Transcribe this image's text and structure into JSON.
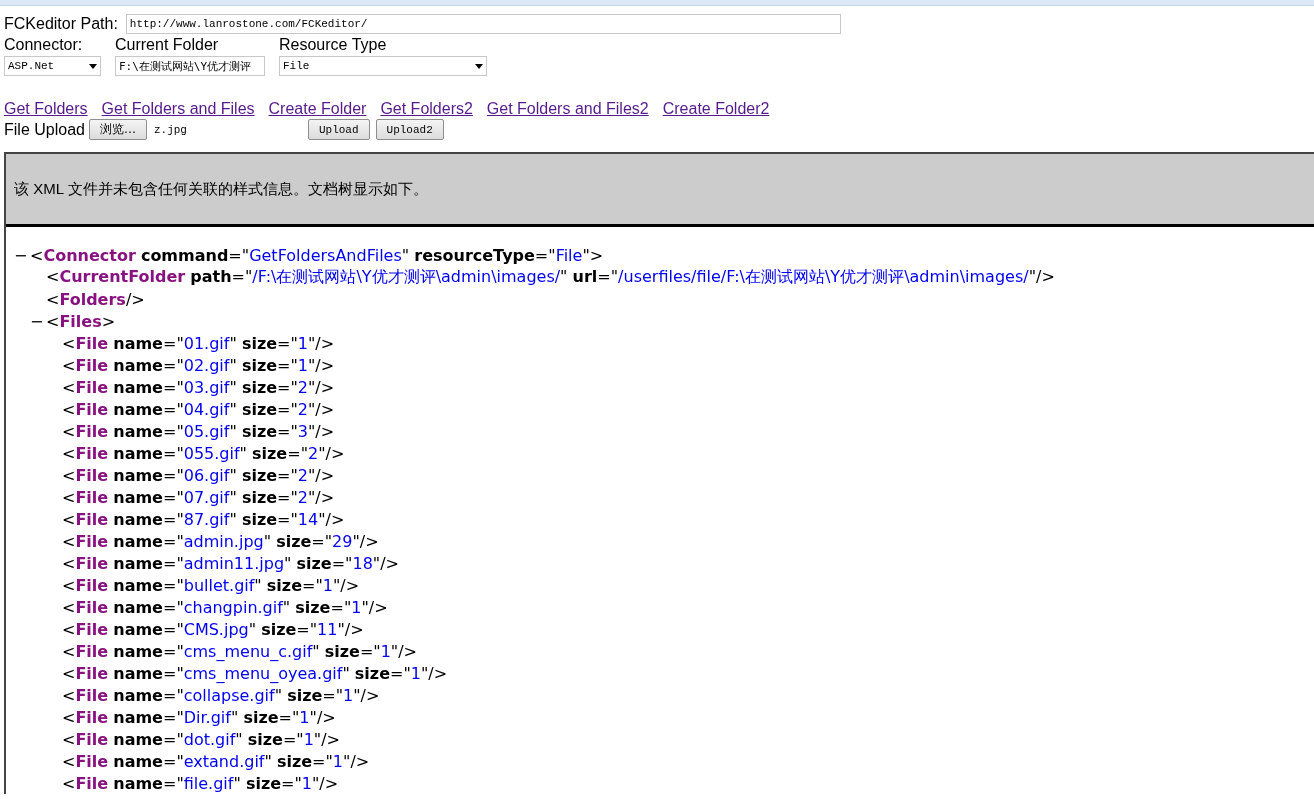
{
  "form": {
    "path_label": "FCKeditor Path:",
    "path_value": "http://www.lanrostone.com/FCKeditor/",
    "connector_label": "Connector:",
    "connector_value": "ASP.Net",
    "folder_label": "Current Folder",
    "folder_value": "F:\\在测试网站\\Y优才测评",
    "resource_label": "Resource Type",
    "resource_value": "File"
  },
  "links": [
    "Get Folders",
    "Get Folders and Files",
    "Create Folder",
    "Get Folders2",
    "Get Folders and Files2",
    "Create Folder2"
  ],
  "upload": {
    "label": "File Upload",
    "browse_button": "浏览…",
    "file_name": "z.jpg",
    "buttons": [
      "Upload",
      "Upload2"
    ]
  },
  "xml_viewer": {
    "notice": "该 XML 文件并未包含任何关联的样式信息。文档树显示如下。",
    "syntax": {
      "lt": "<",
      "gt": ">",
      "self_close": "/>",
      "eq": "=",
      "quote": "\""
    },
    "root": {
      "tag": "Connector",
      "toggle": "−",
      "attrs": [
        {
          "name": "command",
          "value": "GetFoldersAndFiles"
        },
        {
          "name": "resourceType",
          "value": "File"
        }
      ],
      "children": [
        {
          "tag": "CurrentFolder",
          "attrs": [
            {
              "name": "path",
              "value": "/F:\\在测试网站\\Y优才测评\\admin\\images/"
            },
            {
              "name": "url",
              "value": "/userfiles/file/F:\\在测试网站\\Y优才测评\\admin\\images/"
            }
          ]
        },
        {
          "tag": "Folders"
        },
        {
          "tag": "Files",
          "toggle": "−",
          "children": [
            {
              "tag": "File",
              "attrs": [
                {
                  "name": "name",
                  "value": "01.gif"
                },
                {
                  "name": "size",
                  "value": "1"
                }
              ]
            },
            {
              "tag": "File",
              "attrs": [
                {
                  "name": "name",
                  "value": "02.gif"
                },
                {
                  "name": "size",
                  "value": "1"
                }
              ]
            },
            {
              "tag": "File",
              "attrs": [
                {
                  "name": "name",
                  "value": "03.gif"
                },
                {
                  "name": "size",
                  "value": "2"
                }
              ]
            },
            {
              "tag": "File",
              "attrs": [
                {
                  "name": "name",
                  "value": "04.gif"
                },
                {
                  "name": "size",
                  "value": "2"
                }
              ]
            },
            {
              "tag": "File",
              "attrs": [
                {
                  "name": "name",
                  "value": "05.gif"
                },
                {
                  "name": "size",
                  "value": "3"
                }
              ]
            },
            {
              "tag": "File",
              "attrs": [
                {
                  "name": "name",
                  "value": "055.gif"
                },
                {
                  "name": "size",
                  "value": "2"
                }
              ]
            },
            {
              "tag": "File",
              "attrs": [
                {
                  "name": "name",
                  "value": "06.gif"
                },
                {
                  "name": "size",
                  "value": "2"
                }
              ]
            },
            {
              "tag": "File",
              "attrs": [
                {
                  "name": "name",
                  "value": "07.gif"
                },
                {
                  "name": "size",
                  "value": "2"
                }
              ]
            },
            {
              "tag": "File",
              "attrs": [
                {
                  "name": "name",
                  "value": "87.gif"
                },
                {
                  "name": "size",
                  "value": "14"
                }
              ]
            },
            {
              "tag": "File",
              "attrs": [
                {
                  "name": "name",
                  "value": "admin.jpg"
                },
                {
                  "name": "size",
                  "value": "29"
                }
              ]
            },
            {
              "tag": "File",
              "attrs": [
                {
                  "name": "name",
                  "value": "admin11.jpg"
                },
                {
                  "name": "size",
                  "value": "18"
                }
              ]
            },
            {
              "tag": "File",
              "attrs": [
                {
                  "name": "name",
                  "value": "bullet.gif"
                },
                {
                  "name": "size",
                  "value": "1"
                }
              ]
            },
            {
              "tag": "File",
              "attrs": [
                {
                  "name": "name",
                  "value": "changpin.gif"
                },
                {
                  "name": "size",
                  "value": "1"
                }
              ]
            },
            {
              "tag": "File",
              "attrs": [
                {
                  "name": "name",
                  "value": "CMS.jpg"
                },
                {
                  "name": "size",
                  "value": "11"
                }
              ]
            },
            {
              "tag": "File",
              "attrs": [
                {
                  "name": "name",
                  "value": "cms_menu_c.gif"
                },
                {
                  "name": "size",
                  "value": "1"
                }
              ]
            },
            {
              "tag": "File",
              "attrs": [
                {
                  "name": "name",
                  "value": "cms_menu_oyea.gif"
                },
                {
                  "name": "size",
                  "value": "1"
                }
              ]
            },
            {
              "tag": "File",
              "attrs": [
                {
                  "name": "name",
                  "value": "collapse.gif"
                },
                {
                  "name": "size",
                  "value": "1"
                }
              ]
            },
            {
              "tag": "File",
              "attrs": [
                {
                  "name": "name",
                  "value": "Dir.gif"
                },
                {
                  "name": "size",
                  "value": "1"
                }
              ]
            },
            {
              "tag": "File",
              "attrs": [
                {
                  "name": "name",
                  "value": "dot.gif"
                },
                {
                  "name": "size",
                  "value": "1"
                }
              ]
            },
            {
              "tag": "File",
              "attrs": [
                {
                  "name": "name",
                  "value": "extand.gif"
                },
                {
                  "name": "size",
                  "value": "1"
                }
              ]
            },
            {
              "tag": "File",
              "attrs": [
                {
                  "name": "name",
                  "value": "file.gif"
                },
                {
                  "name": "size",
                  "value": "1"
                }
              ]
            }
          ]
        }
      ]
    }
  }
}
